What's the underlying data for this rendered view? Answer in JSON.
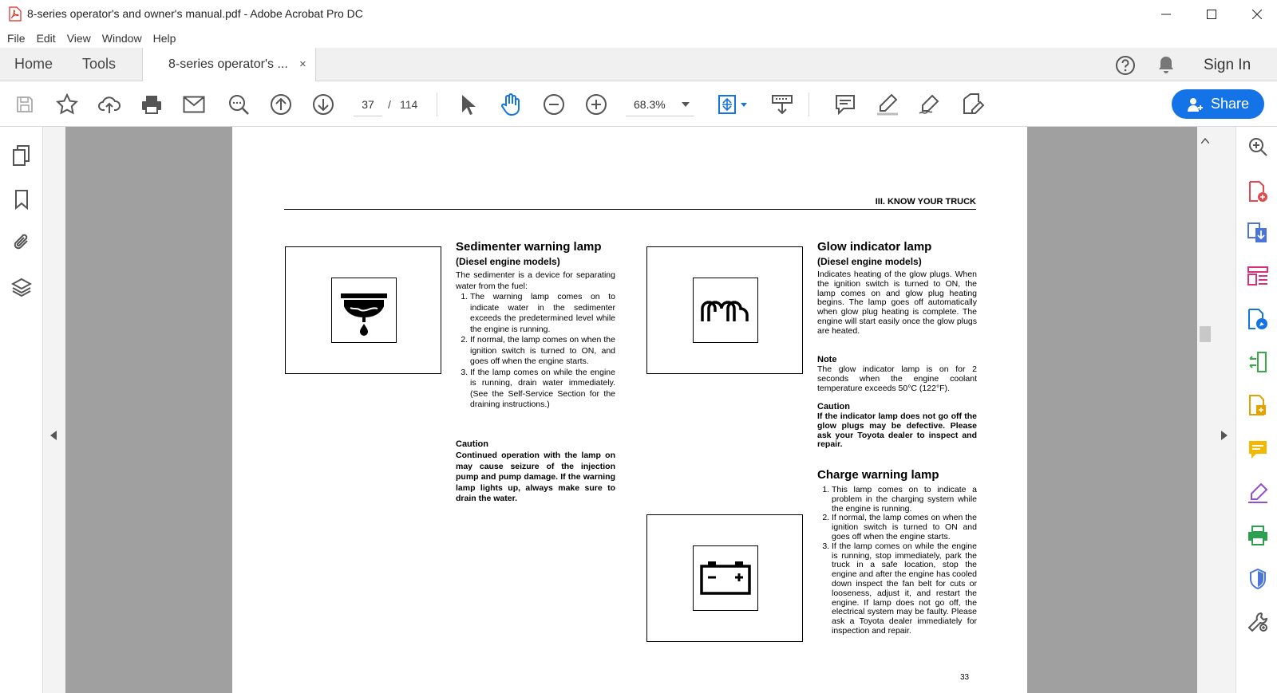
{
  "window": {
    "title": "8-series operator's and owner's manual.pdf - Adobe Acrobat Pro DC"
  },
  "menu": [
    "File",
    "Edit",
    "View",
    "Window",
    "Help"
  ],
  "tabs": {
    "home": "Home",
    "tools": "Tools",
    "document": "8-series operator's ...",
    "close": "×",
    "sign_in": "Sign In"
  },
  "toolbar": {
    "current_page": "37",
    "page_separator": "/",
    "total_pages": "114",
    "zoom": "68.3%",
    "share_label": "Share"
  },
  "colors": {
    "accent": "#1473e6",
    "viewer_bg": "#a0a0a0",
    "tab_bar_bg": "#f0f0f0"
  },
  "document": {
    "header": "III.  KNOW YOUR TRUCK",
    "page_number": "33",
    "sedimenter": {
      "title": "Sedimenter warning lamp",
      "subtitle": "(Diesel engine models)",
      "intro": "The sedimenter is a device for separating water from the fuel:",
      "items": [
        "The warning lamp comes on to indicate water in the sedimenter exceeds the predetermined level while the engine is running.",
        "If normal, the lamp comes on when the ignition switch is turned to ON, and goes off when the engine starts.",
        "If the lamp comes on while the engine is running, drain water immediately. (See the Self-Service Section for the draining instructions.)"
      ],
      "caution_title": "Caution",
      "caution_text": "Continued operation with the lamp on may cause seizure of the injection pump and pump damage. If the warning lamp lights up, always make sure to drain the water."
    },
    "glow": {
      "title": "Glow indicator lamp",
      "subtitle": "(Diesel engine models)",
      "text": "Indicates heating of the glow plugs. When the ignition switch is turned to ON, the lamp comes on and glow plug heating begins. The lamp goes off automatically when glow plug heating is complete. The engine will start easily once the glow plugs are heated.",
      "note_title": "Note",
      "note_text": "The glow indicator lamp is on for 2 seconds when the engine coolant temperature exceeds 50°C (122°F).",
      "caution_title": "Caution",
      "caution_text": "If the indicator lamp does not go off the glow plugs may be defective. Please ask your Toyota dealer to inspect and repair."
    },
    "charge": {
      "title": "Charge warning lamp",
      "items": [
        "This lamp comes on to indicate a problem in the charging system while the engine is running.",
        "If normal, the lamp comes on when the ignition switch is turned to ON and goes off when the engine starts.",
        "If the lamp comes on while the engine is running, stop immediately, park the truck in a safe location, stop the engine and after the engine has cooled down inspect the fan belt for cuts or looseness, adjust it, and restart the engine. If lamp does not go off, the electrical system may be faulty. Please ask a Toyota dealer immediately for inspection and repair."
      ]
    }
  }
}
